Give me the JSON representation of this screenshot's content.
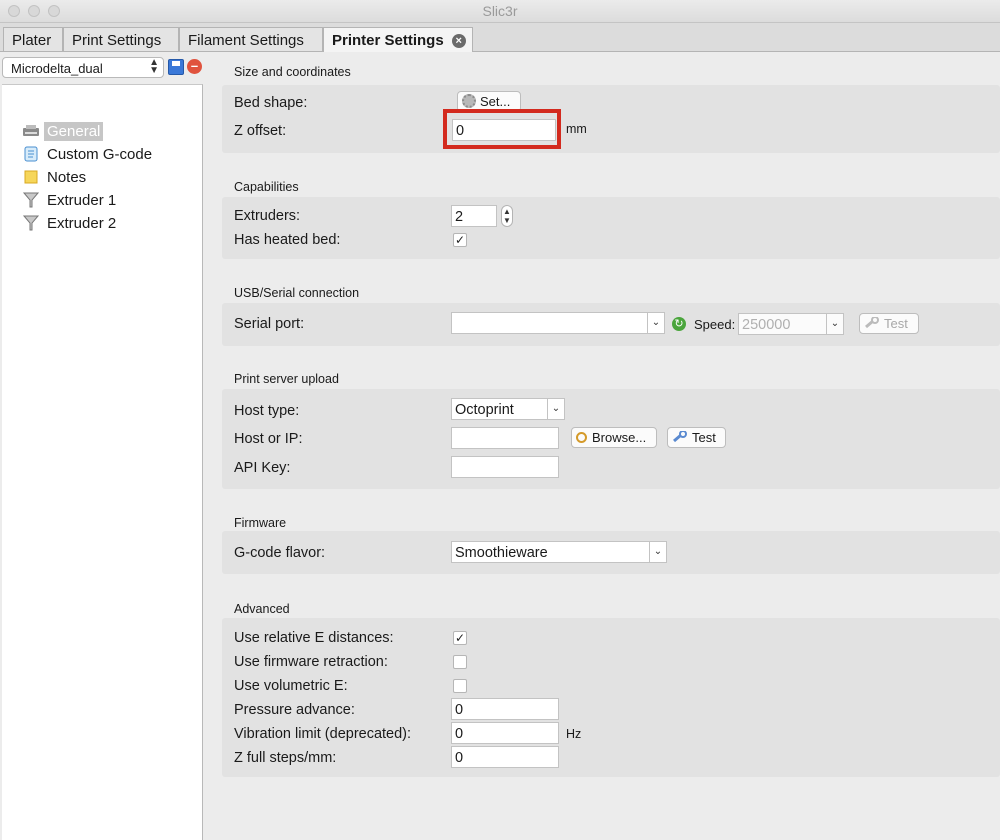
{
  "window": {
    "title": "Slic3r"
  },
  "tabs": [
    {
      "label": "Plater"
    },
    {
      "label": "Print Settings"
    },
    {
      "label": "Filament Settings"
    },
    {
      "label": "Printer Settings"
    }
  ],
  "sidebar": {
    "preset": "Microdelta_dual",
    "items": [
      {
        "label": "General",
        "icon": "printer-icon"
      },
      {
        "label": "Custom G-code",
        "icon": "script-icon"
      },
      {
        "label": "Notes",
        "icon": "note-icon"
      },
      {
        "label": "Extruder 1",
        "icon": "funnel-icon"
      },
      {
        "label": "Extruder 2",
        "icon": "funnel-icon"
      }
    ]
  },
  "size": {
    "title": "Size and coordinates",
    "bed_shape_label": "Bed shape:",
    "bed_shape_button": "Set...",
    "z_offset_label": "Z offset:",
    "z_offset_value": "0",
    "z_offset_unit": "mm"
  },
  "capabilities": {
    "title": "Capabilities",
    "extruders_label": "Extruders:",
    "extruders_value": "2",
    "heated_bed_label": "Has heated bed:",
    "heated_bed_checked": true
  },
  "usb": {
    "title": "USB/Serial connection",
    "serial_port_label": "Serial port:",
    "serial_port_value": "",
    "speed_label": "Speed:",
    "speed_value": "250000",
    "test_button": "Test"
  },
  "print_server": {
    "title": "Print server upload",
    "host_type_label": "Host type:",
    "host_type_value": "Octoprint",
    "host_label": "Host or IP:",
    "host_value": "",
    "browse_button": "Browse...",
    "test_button": "Test",
    "api_key_label": "API Key:",
    "api_key_value": ""
  },
  "firmware": {
    "title": "Firmware",
    "gcode_flavor_label": "G-code flavor:",
    "gcode_flavor_value": "Smoothieware"
  },
  "advanced": {
    "title": "Advanced",
    "relative_e_label": "Use relative E distances:",
    "relative_e_checked": true,
    "firmware_retraction_label": "Use firmware retraction:",
    "firmware_retraction_checked": false,
    "volumetric_e_label": "Use volumetric E:",
    "volumetric_e_checked": false,
    "pressure_advance_label": "Pressure advance:",
    "pressure_advance_value": "0",
    "vibration_limit_label": "Vibration limit (deprecated):",
    "vibration_limit_value": "0",
    "vibration_limit_unit": "Hz",
    "z_full_steps_label": "Z full steps/mm:",
    "z_full_steps_value": "0"
  },
  "colors": {
    "highlight": "#d32a1e",
    "panel": "#e2e2e2",
    "selection": "#c6c6c6"
  }
}
